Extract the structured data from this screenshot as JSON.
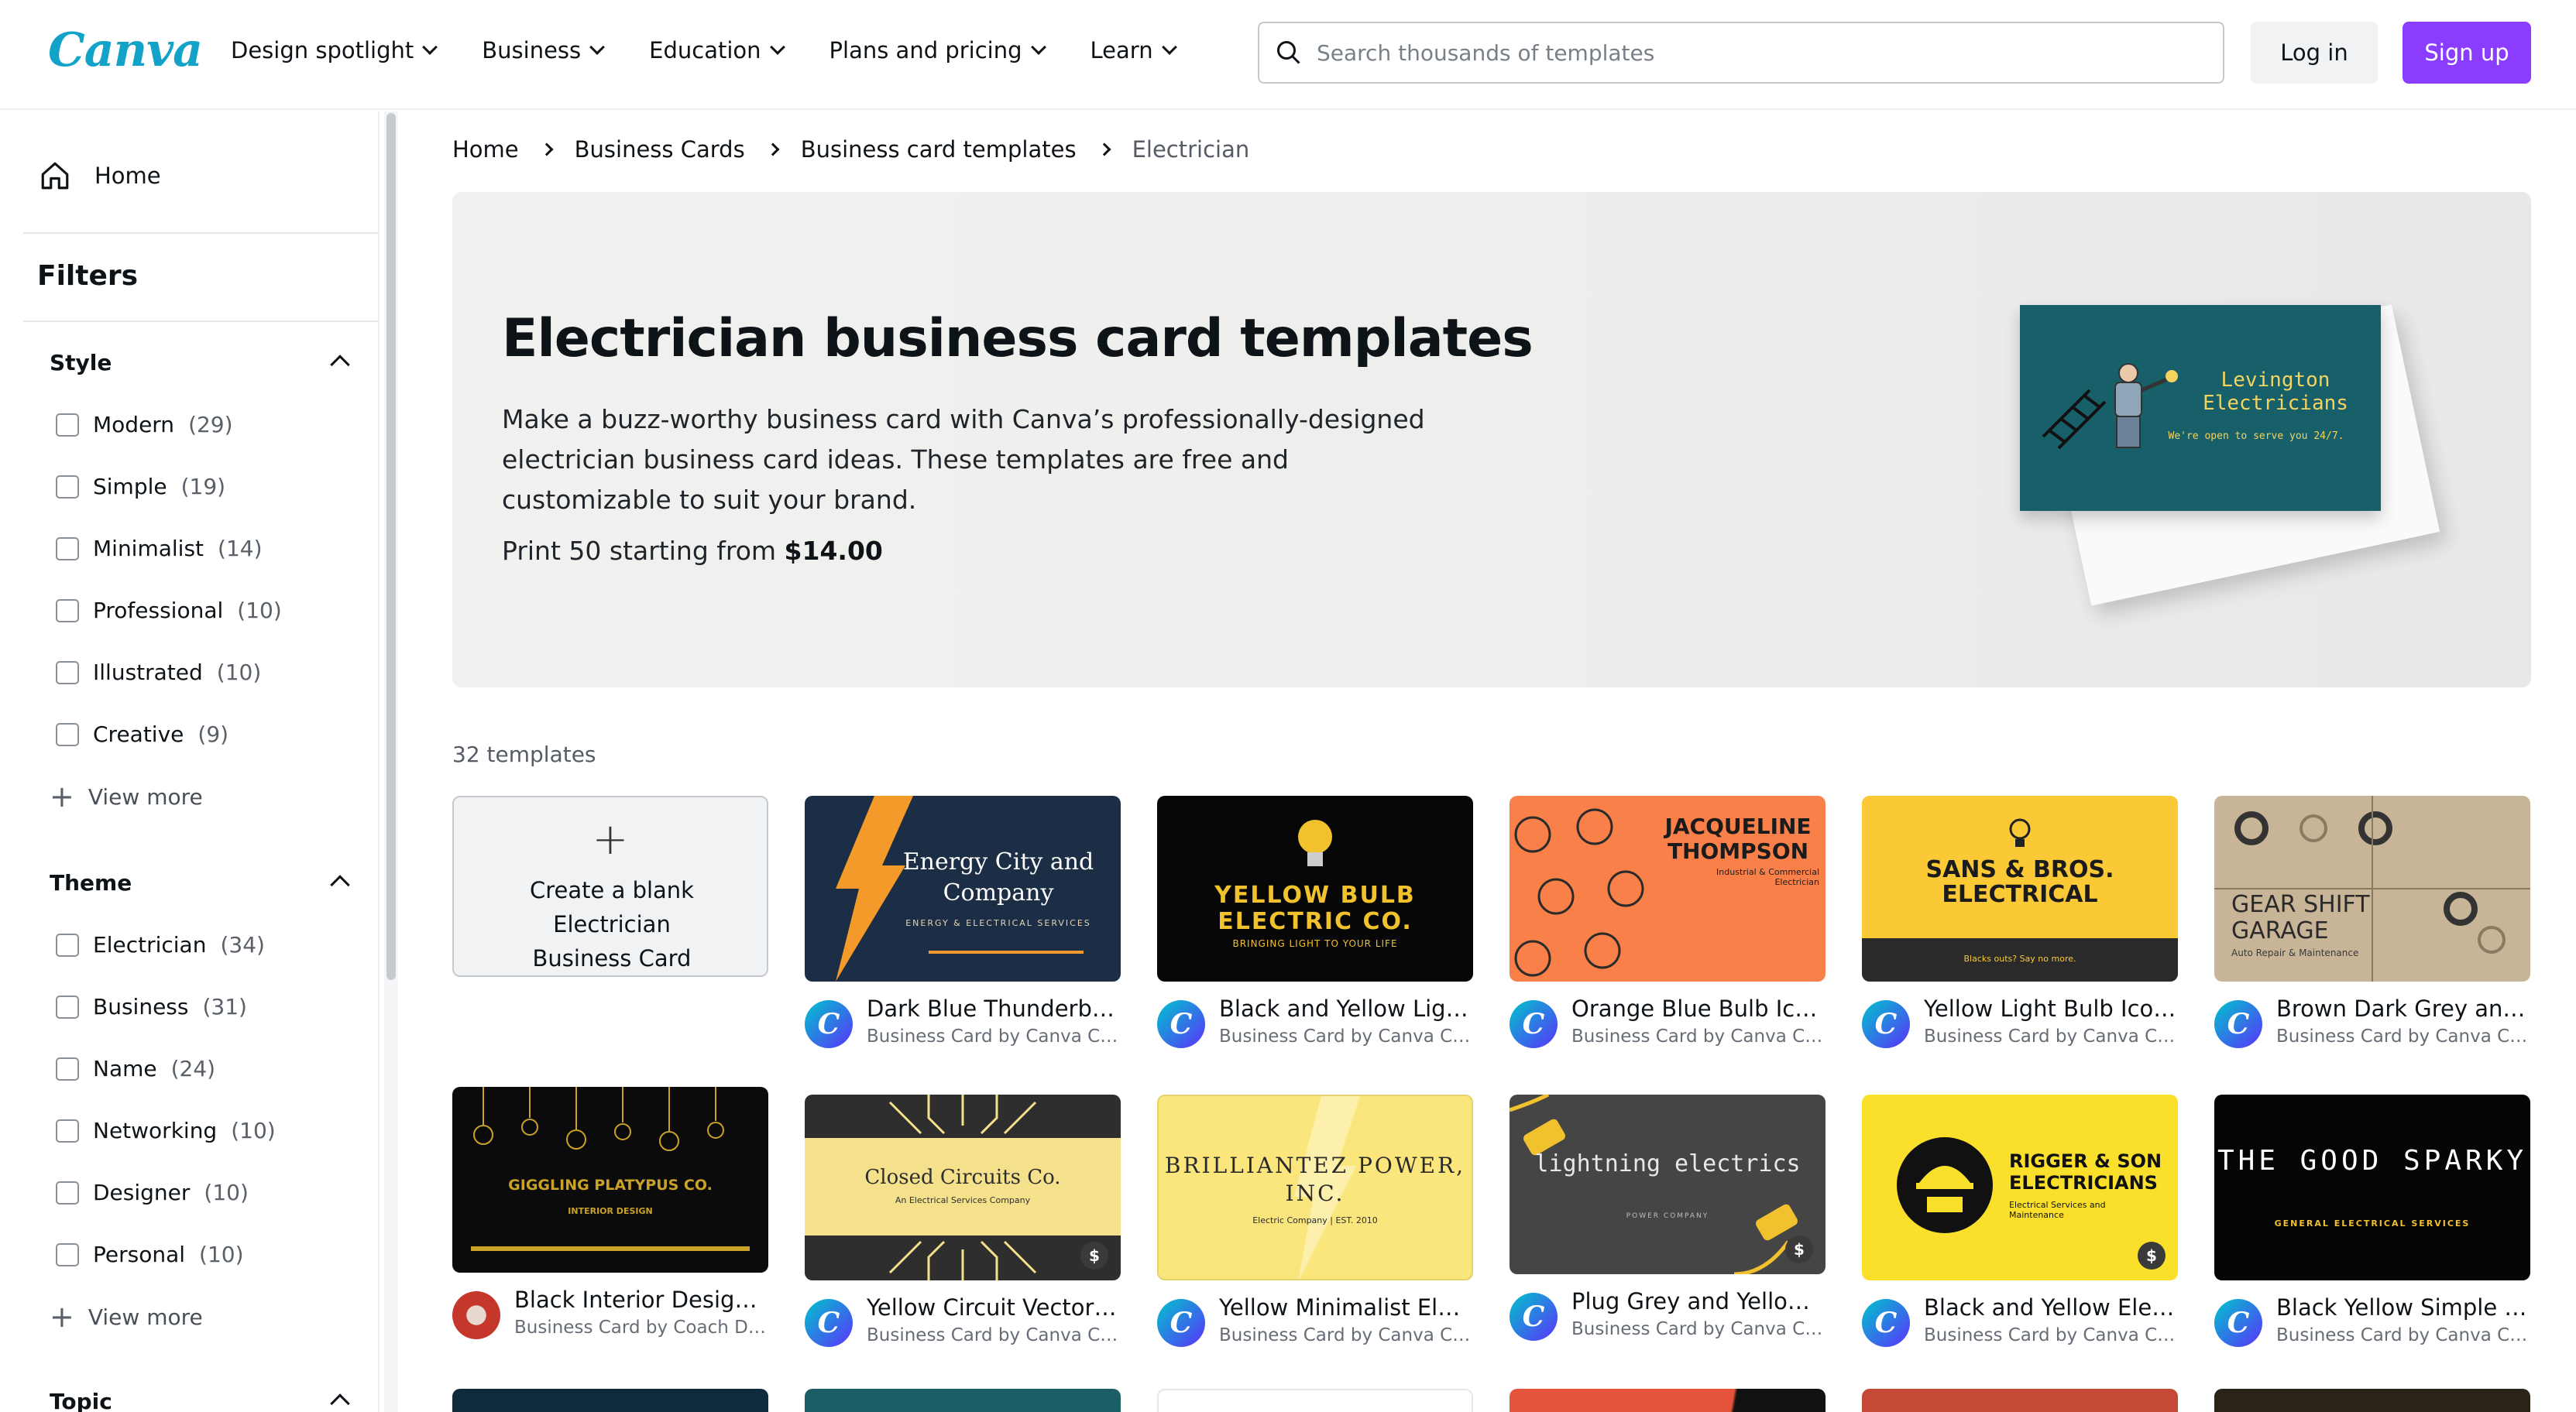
{
  "header": {
    "logo": "Canva",
    "nav": [
      "Design spotlight",
      "Business",
      "Education",
      "Plans and pricing",
      "Learn"
    ],
    "search_placeholder": "Search thousands of templates",
    "login": "Log in",
    "signup": "Sign up"
  },
  "sidebar": {
    "home": "Home",
    "filters": "Filters",
    "style": {
      "title": "Style",
      "options": [
        {
          "label": "Modern",
          "count": "(29)"
        },
        {
          "label": "Simple",
          "count": "(19)"
        },
        {
          "label": "Minimalist",
          "count": "(14)"
        },
        {
          "label": "Professional",
          "count": "(10)"
        },
        {
          "label": "Illustrated",
          "count": "(10)"
        },
        {
          "label": "Creative",
          "count": "(9)"
        }
      ],
      "view_more": "View more"
    },
    "theme": {
      "title": "Theme",
      "options": [
        {
          "label": "Electrician",
          "count": "(34)"
        },
        {
          "label": "Business",
          "count": "(31)"
        },
        {
          "label": "Name",
          "count": "(24)"
        },
        {
          "label": "Networking",
          "count": "(10)"
        },
        {
          "label": "Designer",
          "count": "(10)"
        },
        {
          "label": "Personal",
          "count": "(10)"
        }
      ],
      "view_more": "View more"
    },
    "topic": {
      "title": "Topic"
    }
  },
  "breadcrumb": [
    "Home",
    "Business Cards",
    "Business card templates",
    "Electrician"
  ],
  "hero": {
    "title": "Electrician business card templates",
    "description": "Make a buzz-worthy business card with Canva’s professionally-designed electrician business card ideas. These templates are free and customizable to suit your brand.",
    "price_prefix": "Print 50 starting from ",
    "price": "$14.00",
    "card_name": "Levington Electricians",
    "card_tagline": "We're open to serve you 24/7."
  },
  "template_count": "32 templates",
  "blank_card": {
    "label": "Create a blank Electrician Business Card"
  },
  "templates": [
    {
      "title": "Dark Blue Thunderbolt Electrical Business Card",
      "sub": "Business Card by Canva Creative Studio",
      "thumb_text": "Energy City and Company",
      "thumb_sub": "ENERGY & ELECTRICAL SERVICES"
    },
    {
      "title": "Black and Yellow Light Bulb Business Card",
      "sub": "Business Card by Canva Creative Studio",
      "thumb_text": "YELLOW BULB ELECTRIC CO.",
      "thumb_sub": "BRINGING LIGHT TO YOUR LIFE"
    },
    {
      "title": "Orange Blue Bulb Icon Business Card",
      "sub": "Business Card by Canva Creative Studio",
      "thumb_text": "JACQUELINE THOMPSON",
      "thumb_sub": "Industrial & Commercial Electrician"
    },
    {
      "title": "Yellow Light Bulb Icon Business Card",
      "sub": "Business Card by Canva Creative Studio",
      "thumb_text": "SANS & BROS. ELECTRICAL",
      "thumb_sub": "Blacks outs? Say no more."
    },
    {
      "title": "Brown Dark Grey and Beige Business Card",
      "sub": "Business Card by Canva Creative Studio",
      "thumb_text": "GEAR SHIFT GARAGE",
      "thumb_sub": "Auto Repair & Maintenance"
    },
    {
      "title": "Black Interior Designer Business Card",
      "sub": "Business Card by Coach Design",
      "thumb_text": "GIGGLING PLATYPUS CO.",
      "thumb_sub": "INTERIOR DESIGN"
    },
    {
      "title": "Yellow Circuit Vector Business Card",
      "sub": "Business Card by Canva Creative Studio",
      "thumb_text": "Closed Circuits Co.",
      "thumb_sub": "An Electrical Services Company"
    },
    {
      "title": "Yellow Minimalist Electrical Business Card",
      "sub": "Business Card by Canva Creative Studio",
      "thumb_text": "BRILLIANTEZ POWER, INC.",
      "thumb_sub": "Electric Company | EST. 2010"
    },
    {
      "title": "Plug Grey and Yellow Business Card",
      "sub": "Business Card by Canva Creative Studio",
      "thumb_text": "lightning electrics",
      "thumb_sub": "POWER COMPANY"
    },
    {
      "title": "Black and Yellow Electrician Business Card",
      "sub": "Business Card by Canva Creative Studio",
      "thumb_text": "RIGGER & SON ELECTRICIANS",
      "thumb_sub": "Electrical Services and Maintenance"
    },
    {
      "title": "Black Yellow Simple Professional Business Card",
      "sub": "Business Card by Canva Creative Studio",
      "thumb_text": "THE GOOD SPARKY",
      "thumb_sub": "GENERAL ELECTRICAL SERVICES"
    }
  ],
  "paid_badge": "$",
  "colors": {
    "accent": "#8b3dff",
    "logo": "#13a3c9"
  }
}
